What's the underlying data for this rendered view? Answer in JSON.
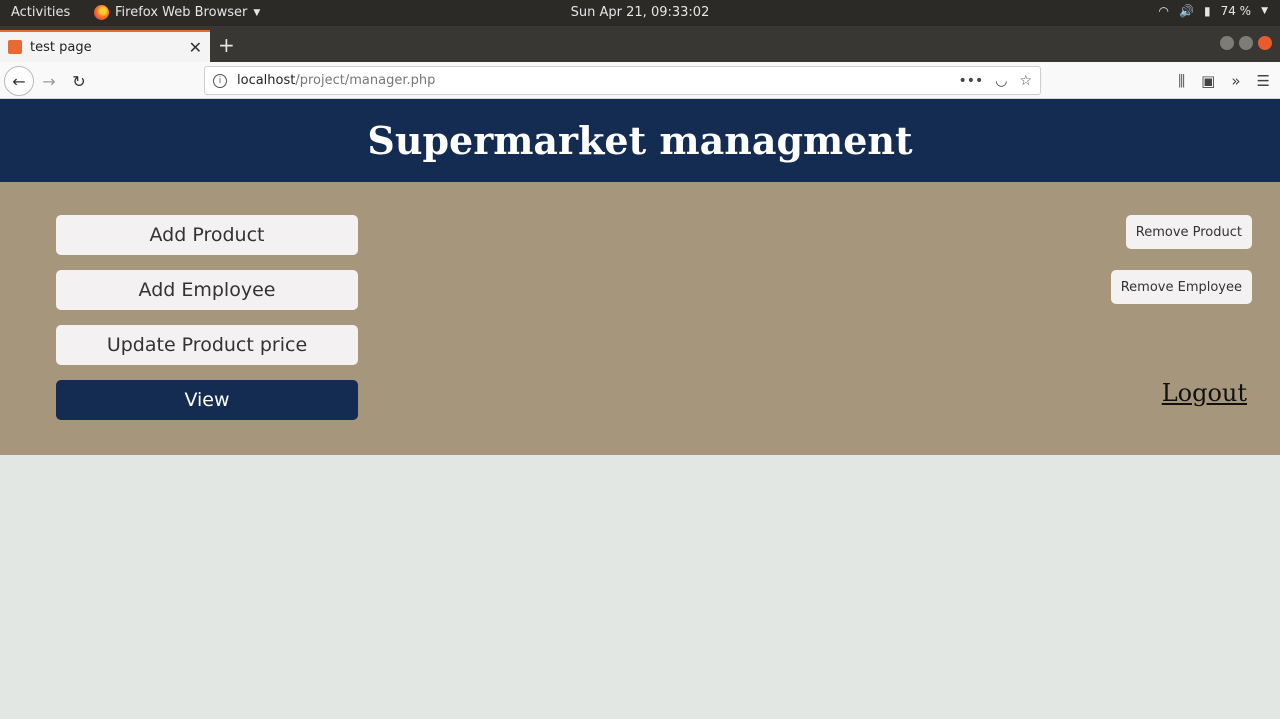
{
  "system": {
    "activities": "Activities",
    "app_name": "Firefox Web Browser",
    "clock": "Sun Apr 21, 09:33:02",
    "battery": "74 %"
  },
  "browser": {
    "tab_title": "test page",
    "url_host": "localhost",
    "url_path": "/project/manager.php"
  },
  "page": {
    "title": "Supermarket managment",
    "left_buttons": {
      "add_product": "Add Product",
      "add_employee": "Add Employee",
      "update_price": "Update Product price",
      "view": "View"
    },
    "right_buttons": {
      "remove_product": "Remove Product",
      "remove_employee": "Remove Employee"
    },
    "logout": "Logout"
  },
  "colors": {
    "header_bg": "#142b52",
    "panel_bg": "#a6967c",
    "page_bg": "#e2e7e3"
  }
}
